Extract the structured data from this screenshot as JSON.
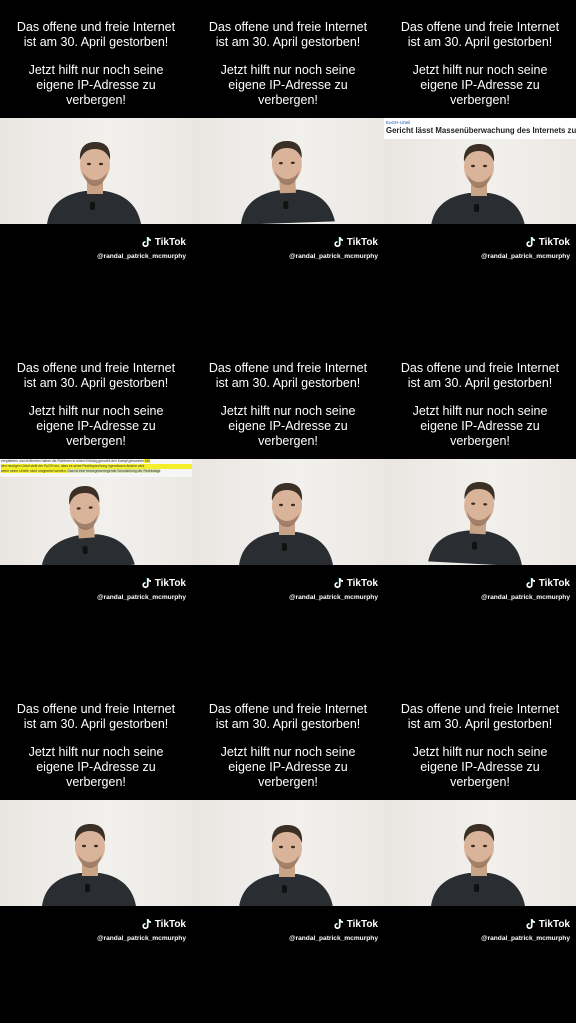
{
  "caption": {
    "line1": "Das offene und freie Internet",
    "line2": "ist am 30. April gestorben!",
    "line3": "Jetzt hilft nur noch seine",
    "line4": "eigene IP-Adresse zu",
    "line5": "verbergen!"
  },
  "tiktok": {
    "brand": "TikTok",
    "handle": "@randal_patrick_mcmurphy",
    "icon": "tiktok-note-icon"
  },
  "news_overlay": {
    "kicker": "EuGH-Urteil",
    "headline": "Gericht lässt Massenüberwachung des Internets zu"
  },
  "text_overlay": {
    "line1": "verpatteten und eröffneten haben die Richtinen in ",
    "line1b": "einem Einklag gesucht den Kampf gewonnen",
    "line1c": " Mit",
    "line2": "den heutigen Urteil stellt der EuGH ein, dass es seine Rechtsprechung",
    "line2b": " irgendwann ändern wird",
    "line3": "wenn seine Urteile nicht umgesetzt werden.",
    "line3b": " Das ist eine besorgniserregende Schwächung der Rechtslage"
  },
  "colors": {
    "background": "#000000",
    "text": "#ffffff",
    "wall": "#ece9e5",
    "shirt": "#2a2e33",
    "skin": "#d9b49a",
    "hair": "#3b2f26",
    "highlight": "#f3ef29"
  }
}
